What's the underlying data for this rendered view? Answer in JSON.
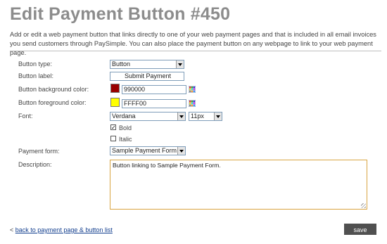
{
  "page": {
    "title": "Edit Payment Button #450",
    "intro": "Add or edit a web payment button that links directly to one of your web payment pages and that is included in all email invoices you send customers through PaySimple. You can also place the payment button on any webpage to link to your web payment page."
  },
  "form": {
    "button_type": {
      "label": "Button type:",
      "value": "Button"
    },
    "button_label": {
      "label": "Button label:",
      "value": "Submit Payment"
    },
    "bg_color": {
      "label": "Button background color:",
      "value": "990000",
      "swatch": "#990000"
    },
    "fg_color": {
      "label": "Button foreground color:",
      "value": "FFFF00",
      "swatch": "#FFFF00"
    },
    "font": {
      "label": "Font:",
      "family": "Verdana",
      "size": "11px"
    },
    "bold": {
      "label": "Bold",
      "checked": true
    },
    "italic": {
      "label": "Italic",
      "checked": false
    },
    "payment_form": {
      "label": "Payment form:",
      "value": "Sample Payment Form"
    },
    "description": {
      "label": "Description:",
      "value": "Button linking to Sample Payment Form."
    }
  },
  "footer": {
    "back_prefix": "<",
    "back_link": "back to payment page & button list",
    "save_label": "save"
  },
  "icons": {
    "color_picker": "palette-grid-icon",
    "dropdown": "chevron-down-icon",
    "checkmark": "checkmark-icon",
    "resize": "resize-grip-icon"
  }
}
